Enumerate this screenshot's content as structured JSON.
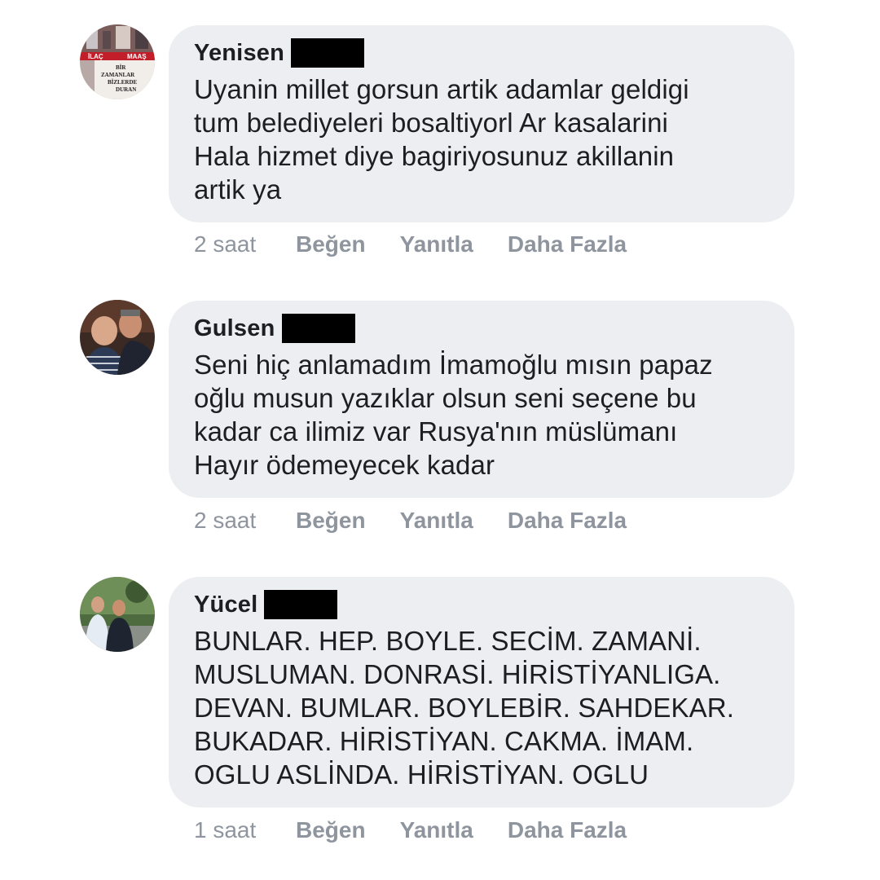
{
  "comments": [
    {
      "author": "Yenisen",
      "avatar_text": [
        "İLAÇ",
        "MAAŞ",
        "BİR",
        "ZAMANLAR",
        "BİZLERDE",
        "DURAN"
      ],
      "text_lines": [
        "Uyanin millet gorsun artik adamlar geldigi",
        "tum belediyeleri bosaltiyorl Ar kasalarini",
        "Hala hizmet diye bagiriyosunuz akillanin",
        "artik ya"
      ],
      "time": "2 saat",
      "like": "Beğen",
      "reply": "Yanıtla",
      "more": "Daha Fazla"
    },
    {
      "author": "Gulsen",
      "text_lines": [
        "Seni hiç anlamadım İmamoğlu mısın papaz",
        "oğlu musun yazıklar olsun seni seçene bu",
        "kadar ca ilimiz var Rusya'nın müslümanı",
        "Hayır ödemeyecek kadar"
      ],
      "time": "2 saat",
      "like": "Beğen",
      "reply": "Yanıtla",
      "more": "Daha Fazla"
    },
    {
      "author": "Yücel",
      "text_lines": [
        "BUNLAR. HEP. BOYLE. SECİM. ZAMANİ.",
        "MUSLUMAN. DONRASİ. HİRİSTİYANLIGA.",
        "DEVAN. BUMLAR. BOYLEBİR. SAHDEKAR.",
        "BUKADAR. HİRİSTİYAN. CAKMA. İMAM.",
        "OGLU ASLİNDA. HİRİSTİYAN. OGLU"
      ],
      "time": "1 saat",
      "like": "Beğen",
      "reply": "Yanıtla",
      "more": "Daha Fazla"
    }
  ]
}
